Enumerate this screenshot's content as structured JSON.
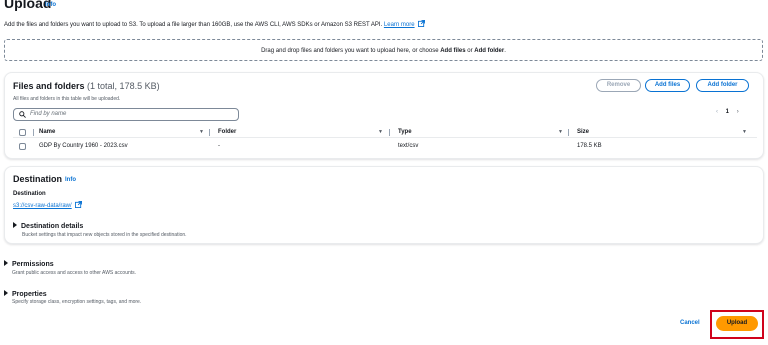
{
  "page": {
    "title": "Upload",
    "info": "Info",
    "intro_text": "Add the files and folders you want to upload to S3. To upload a file larger than 160GB, use the AWS CLI, AWS SDKs or Amazon S3 REST API.",
    "learn_more": "Learn more"
  },
  "dropzone": {
    "prefix": "Drag and drop files and folders you want to upload here, or choose ",
    "add_files": "Add files",
    "or": " or ",
    "add_folder": "Add folder",
    "suffix": "."
  },
  "files": {
    "title": "Files and folders",
    "count": "(1 total, 178.5 KB)",
    "subtitle": "All files and folders in this table will be uploaded.",
    "buttons": {
      "remove": "Remove",
      "add_files": "Add files",
      "add_folder": "Add folder"
    },
    "search_placeholder": "Find by name",
    "page_number": "1",
    "columns": [
      "Name",
      "Folder",
      "Type",
      "Size"
    ],
    "rows": [
      {
        "name": "GDP By Country 1960 - 2023.csv",
        "folder": "-",
        "type": "text/csv",
        "size": "178.5 KB"
      }
    ]
  },
  "destination": {
    "title": "Destination",
    "info": "Info",
    "label": "Destination",
    "path": "s3://csv-raw-data/raw/",
    "details_title": "Destination details",
    "details_sub": "Bucket settings that impact new objects stored in the specified destination."
  },
  "permissions": {
    "title": "Permissions",
    "sub": "Grant public access and access to other AWS accounts."
  },
  "properties": {
    "title": "Properties",
    "sub": "Specify storage class, encryption settings, tags, and more."
  },
  "footer": {
    "cancel": "Cancel",
    "upload": "Upload"
  },
  "colors": {
    "link": "#0972d3",
    "primary": "#ff9900",
    "highlight": "#d0021b"
  }
}
